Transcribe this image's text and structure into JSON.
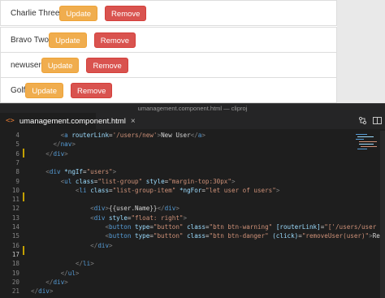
{
  "users": [
    {
      "name": "Charlie Three",
      "update_label": "Update",
      "remove_label": "Remove"
    },
    {
      "name": "Bravo Two",
      "update_label": "Update",
      "remove_label": "Remove"
    },
    {
      "name": "newuser",
      "update_label": "Update",
      "remove_label": "Remove"
    },
    {
      "name": "Golf",
      "update_label": "Update",
      "remove_label": "Remove"
    }
  ],
  "editor": {
    "window_title": "umanagement.component.html — cliproj",
    "tab_label": "umanagement.component.html",
    "tab_icon": "html-file-icon",
    "tab_close": "×",
    "toolbar_icons": [
      "compare-changes-icon",
      "split-editor-icon"
    ],
    "lines": [
      {
        "num": "4",
        "text": "        <a routerLink='/users/new'>New User</a>"
      },
      {
        "num": "5",
        "text": "      </nav>"
      },
      {
        "num": "6",
        "text": "    </div>"
      },
      {
        "num": "7",
        "text": ""
      },
      {
        "num": "8",
        "text": "    <div *ngIf=\"users\">"
      },
      {
        "num": "9",
        "text": "        <ul class=\"list-group\" style=\"margin-top:30px\">"
      },
      {
        "num": "10",
        "text": "            <li class=\"list-group-item\" *ngFor=\"let user of users\">"
      },
      {
        "num": "11",
        "text": ""
      },
      {
        "num": "12",
        "text": "                <div>{{user.Name}}</div>"
      },
      {
        "num": "13",
        "text": "                <div style=\"float: right\">"
      },
      {
        "num": "14",
        "text": "                    <button type=\"button\" class=\"btn btn-warning\" [routerLink]=\"['/users/user"
      },
      {
        "num": "15",
        "text": "                    <button type=\"button\" class=\"btn btn-danger\" (click)=\"removeUser(user)\">Re"
      },
      {
        "num": "16",
        "text": "                </div>"
      },
      {
        "num": "17",
        "text": ""
      },
      {
        "num": "18",
        "text": "            </li>"
      },
      {
        "num": "19",
        "text": "        </ul>"
      },
      {
        "num": "20",
        "text": "    </div>"
      },
      {
        "num": "21",
        "text": "</div>"
      }
    ]
  },
  "colors": {
    "warning": "#f0ad4e",
    "danger": "#d9534f",
    "editor_bg": "#1e1e1e"
  }
}
